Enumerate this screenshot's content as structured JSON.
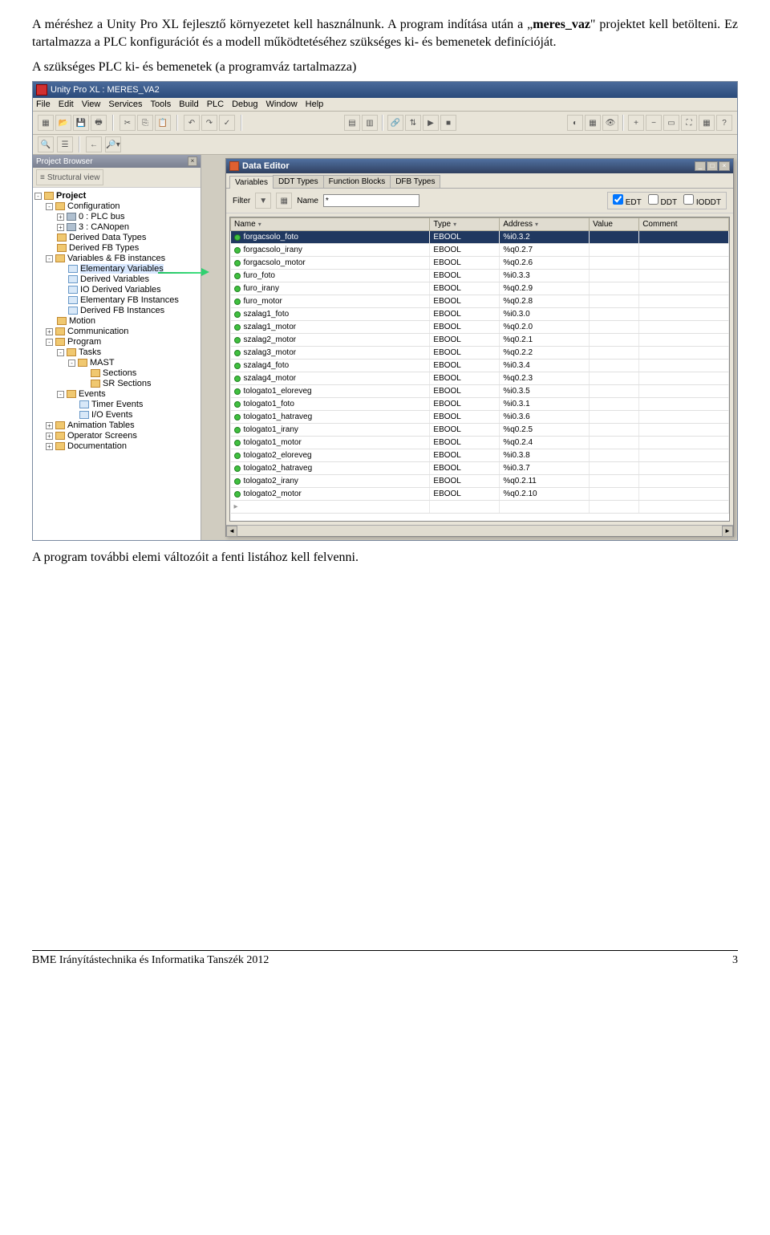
{
  "doc": {
    "para1_prefix": "A méréshez a Unity Pro XL fejlesztő környezetet kell használnunk. A program indítása után a „",
    "para1_bold": "meres_vaz",
    "para1_suffix": "\" projektet kell betölteni. Ez tartalmazza a PLC konfigurációt és a modell működtetéséhez szükséges ki- és bemenetek definícióját.",
    "para2": "A szükséges PLC ki- és bemenetek (a programváz tartalmazza)",
    "para3": "A program további elemi változóit a fenti listához kell felvenni.",
    "footer_left": "BME Irányítástechnika és Informatika Tanszék 2012",
    "footer_right": "3"
  },
  "app": {
    "title": "Unity Pro XL : MERES_VA2",
    "menu": [
      "File",
      "Edit",
      "View",
      "Services",
      "Tools",
      "Build",
      "PLC",
      "Debug",
      "Window",
      "Help"
    ]
  },
  "projectBrowser": {
    "title": "Project Browser",
    "viewButton": "Structural view",
    "root": "Project",
    "items": [
      {
        "label": "Configuration",
        "icon": "folder",
        "exp": "-",
        "level": 1
      },
      {
        "label": "0 : PLC bus",
        "icon": "hw",
        "exp": "+",
        "level": 2
      },
      {
        "label": "3 : CANopen",
        "icon": "hw",
        "exp": "+",
        "level": 2
      },
      {
        "label": "Derived Data Types",
        "icon": "folder",
        "exp": "",
        "level": 1
      },
      {
        "label": "Derived FB Types",
        "icon": "folder",
        "exp": "",
        "level": 1
      },
      {
        "label": "Variables & FB instances",
        "icon": "folder",
        "exp": "-",
        "level": 1
      },
      {
        "label": "Elementary Variables",
        "icon": "file",
        "exp": "",
        "level": 2,
        "hl": true
      },
      {
        "label": "Derived Variables",
        "icon": "file",
        "exp": "",
        "level": 2
      },
      {
        "label": "IO Derived Variables",
        "icon": "file",
        "exp": "",
        "level": 2
      },
      {
        "label": "Elementary FB Instances",
        "icon": "file",
        "exp": "",
        "level": 2
      },
      {
        "label": "Derived FB Instances",
        "icon": "file",
        "exp": "",
        "level": 2
      },
      {
        "label": "Motion",
        "icon": "folder",
        "exp": "",
        "level": 1
      },
      {
        "label": "Communication",
        "icon": "folder",
        "exp": "+",
        "level": 1
      },
      {
        "label": "Program",
        "icon": "folder",
        "exp": "-",
        "level": 1
      },
      {
        "label": "Tasks",
        "icon": "folder",
        "exp": "-",
        "level": 2
      },
      {
        "label": "MAST",
        "icon": "folder",
        "exp": "-",
        "level": 3
      },
      {
        "label": "Sections",
        "icon": "folder",
        "exp": "",
        "level": 4
      },
      {
        "label": "SR Sections",
        "icon": "folder",
        "exp": "",
        "level": 4
      },
      {
        "label": "Events",
        "icon": "folder",
        "exp": "-",
        "level": 2
      },
      {
        "label": "Timer Events",
        "icon": "file",
        "exp": "",
        "level": 3
      },
      {
        "label": "I/O Events",
        "icon": "file",
        "exp": "",
        "level": 3
      },
      {
        "label": "Animation Tables",
        "icon": "folder",
        "exp": "+",
        "level": 1
      },
      {
        "label": "Operator Screens",
        "icon": "folder",
        "exp": "+",
        "level": 1
      },
      {
        "label": "Documentation",
        "icon": "folder",
        "exp": "+",
        "level": 1
      }
    ]
  },
  "dataEditor": {
    "title": "Data Editor",
    "tabs": [
      "Variables",
      "DDT Types",
      "Function Blocks",
      "DFB Types"
    ],
    "activeTab": 0,
    "filterLabel": "Filter",
    "nameLabel": "Name",
    "filterValue": "*",
    "checks": [
      {
        "label": "EDT",
        "checked": true
      },
      {
        "label": "DDT",
        "checked": false
      },
      {
        "label": "IODDT",
        "checked": false
      }
    ],
    "columns": [
      "Name",
      "Type",
      "Address",
      "Value",
      "Comment"
    ],
    "rows": [
      {
        "name": "forgacsolo_foto",
        "type": "EBOOL",
        "addr": "%i0.3.2",
        "sel": true
      },
      {
        "name": "forgacsolo_irany",
        "type": "EBOOL",
        "addr": "%q0.2.7"
      },
      {
        "name": "forgacsolo_motor",
        "type": "EBOOL",
        "addr": "%q0.2.6"
      },
      {
        "name": "furo_foto",
        "type": "EBOOL",
        "addr": "%i0.3.3"
      },
      {
        "name": "furo_irany",
        "type": "EBOOL",
        "addr": "%q0.2.9"
      },
      {
        "name": "furo_motor",
        "type": "EBOOL",
        "addr": "%q0.2.8"
      },
      {
        "name": "szalag1_foto",
        "type": "EBOOL",
        "addr": "%i0.3.0"
      },
      {
        "name": "szalag1_motor",
        "type": "EBOOL",
        "addr": "%q0.2.0"
      },
      {
        "name": "szalag2_motor",
        "type": "EBOOL",
        "addr": "%q0.2.1"
      },
      {
        "name": "szalag3_motor",
        "type": "EBOOL",
        "addr": "%q0.2.2"
      },
      {
        "name": "szalag4_foto",
        "type": "EBOOL",
        "addr": "%i0.3.4"
      },
      {
        "name": "szalag4_motor",
        "type": "EBOOL",
        "addr": "%q0.2.3"
      },
      {
        "name": "tologato1_eloreveg",
        "type": "EBOOL",
        "addr": "%i0.3.5"
      },
      {
        "name": "tologato1_foto",
        "type": "EBOOL",
        "addr": "%i0.3.1"
      },
      {
        "name": "tologato1_hatraveg",
        "type": "EBOOL",
        "addr": "%i0.3.6"
      },
      {
        "name": "tologato1_irany",
        "type": "EBOOL",
        "addr": "%q0.2.5"
      },
      {
        "name": "tologato1_motor",
        "type": "EBOOL",
        "addr": "%q0.2.4"
      },
      {
        "name": "tologato2_eloreveg",
        "type": "EBOOL",
        "addr": "%i0.3.8"
      },
      {
        "name": "tologato2_hatraveg",
        "type": "EBOOL",
        "addr": "%i0.3.7"
      },
      {
        "name": "tologato2_irany",
        "type": "EBOOL",
        "addr": "%q0.2.11"
      },
      {
        "name": "tologato2_motor",
        "type": "EBOOL",
        "addr": "%q0.2.10"
      }
    ]
  }
}
